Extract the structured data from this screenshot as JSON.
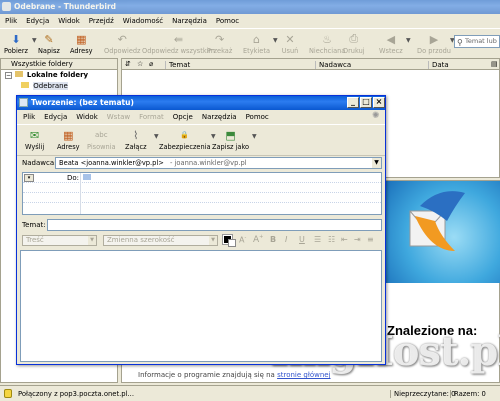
{
  "main": {
    "title": "Odebrane - Thunderbird",
    "menu": [
      "Plik",
      "Edycja",
      "Widok",
      "Przejdź",
      "Wiadomość",
      "Narzędzia",
      "Pomoc"
    ],
    "toolbar": [
      {
        "label": "Pobierz",
        "icon": "get-mail-icon",
        "disabled": false
      },
      {
        "label": "Napisz",
        "icon": "compose-icon",
        "disabled": false
      },
      {
        "label": "Adresy",
        "icon": "address-book-icon",
        "disabled": false
      },
      {
        "label": "Odpowiedz",
        "icon": "reply-icon",
        "disabled": true
      },
      {
        "label": "Odpowiedz wszystkim",
        "icon": "reply-all-icon",
        "disabled": true
      },
      {
        "label": "Przekaż",
        "icon": "forward-icon",
        "disabled": true
      },
      {
        "label": "Etykieta",
        "icon": "tag-icon",
        "disabled": true
      },
      {
        "label": "Usuń",
        "icon": "delete-icon",
        "disabled": true
      },
      {
        "label": "Niechciana",
        "icon": "junk-icon",
        "disabled": true
      },
      {
        "label": "Drukuj",
        "icon": "print-icon",
        "disabled": true
      },
      {
        "label": "Wstecz",
        "icon": "back-icon",
        "disabled": true
      },
      {
        "label": "Do przodu",
        "icon": "forward-nav-icon",
        "disabled": true
      }
    ],
    "search_placeholder": "Temat lub",
    "folder_pane_header": "Wszystkie foldery",
    "folders": [
      {
        "label": "Lokalne foldery"
      },
      {
        "label": "Odebrane"
      }
    ],
    "columns": {
      "subject": "Temat",
      "sender": "Nadawca",
      "date": "Data"
    },
    "preview_found": "Znalezione na:",
    "info_text": "Informacje o programie znajdują się na",
    "info_link": "stronie głównej",
    "status_text": "Połączony z pop3.poczta.onet.pl...",
    "unread_label": "Nieprzeczytane: 0",
    "total_label": "Razem: 0",
    "watermark": "ImgHost.pl"
  },
  "compose": {
    "title": "Tworzenie: (bez tematu)",
    "menu": [
      "Plik",
      "Edycja",
      "Widok",
      "Wstaw",
      "Format",
      "Opcje",
      "Narzędzia",
      "Pomoc"
    ],
    "menu_disabled": [
      false,
      false,
      false,
      true,
      true,
      false,
      false,
      false
    ],
    "toolbar": [
      {
        "label": "Wyślij",
        "icon": "send-icon",
        "disabled": false
      },
      {
        "label": "Adresy",
        "icon": "address-book-icon",
        "disabled": false
      },
      {
        "label": "Pisownia",
        "icon": "spelling-icon",
        "disabled": true
      },
      {
        "label": "Załącz",
        "icon": "paperclip-icon",
        "disabled": false
      },
      {
        "label": "Zabezpieczenia",
        "icon": "lock-icon",
        "disabled": false
      },
      {
        "label": "Zapisz jako",
        "icon": "save-icon",
        "disabled": false
      }
    ],
    "from_label": "Nadawca:",
    "from_value": "Beata <joanna.winkler@vp.pl>",
    "from_account": "- joanna.winkler@vp.pl",
    "to_label": "Do:",
    "subject_label": "Temat:",
    "subject_value": "",
    "format_style": "Treść",
    "format_font": "Zmienna szerokość",
    "format_buttons": [
      "B",
      "I",
      "U"
    ]
  }
}
